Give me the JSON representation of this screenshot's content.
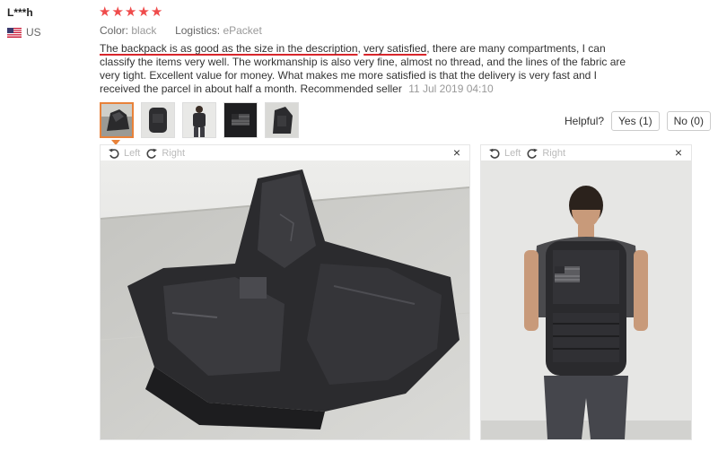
{
  "user": {
    "name": "L***h",
    "country": "US",
    "flag_icon": "us-flag-icon"
  },
  "rating": {
    "stars": 5,
    "max": 5,
    "star_color": "#ef4b4b"
  },
  "meta": {
    "color_label": "Color:",
    "color_value": "black",
    "logistics_label": "Logistics:",
    "logistics_value": "ePacket"
  },
  "review": {
    "part1": "The backpack is as good as the size in the description",
    "part2": ", ",
    "part3": "very satisfied",
    "part4": ", there are many compartments, I can classify the items very well. The workmanship is also very fine, almost no thread, and the lines of the fabric are very tight. Excellent value for money. What makes me more satisfied is that the delivery is very fast and I received the parcel in about half a month. Recommended seller",
    "date": "11 Jul 2019 04:10",
    "underline_color": "#d8262b"
  },
  "thumbnails": [
    {
      "name": "thumbnail-1-open-backpack",
      "active": true
    },
    {
      "name": "thumbnail-2-backpack-front",
      "active": false
    },
    {
      "name": "thumbnail-3-person-wearing",
      "active": false
    },
    {
      "name": "thumbnail-4-flag-patch",
      "active": false
    },
    {
      "name": "thumbnail-5-backpack-side",
      "active": false
    }
  ],
  "helpful": {
    "label": "Helpful?",
    "yes_label": "Yes (1)",
    "no_label": "No (0)"
  },
  "viewers": [
    {
      "left_label": "Left",
      "right_label": "Right",
      "close": "×",
      "image": "open-backpack-photo"
    },
    {
      "left_label": "Left",
      "right_label": "Right",
      "close": "×",
      "image": "person-wearing-backpack-photo"
    }
  ],
  "colors": {
    "accent_orange": "#e8823a",
    "muted_text": "#999999"
  }
}
